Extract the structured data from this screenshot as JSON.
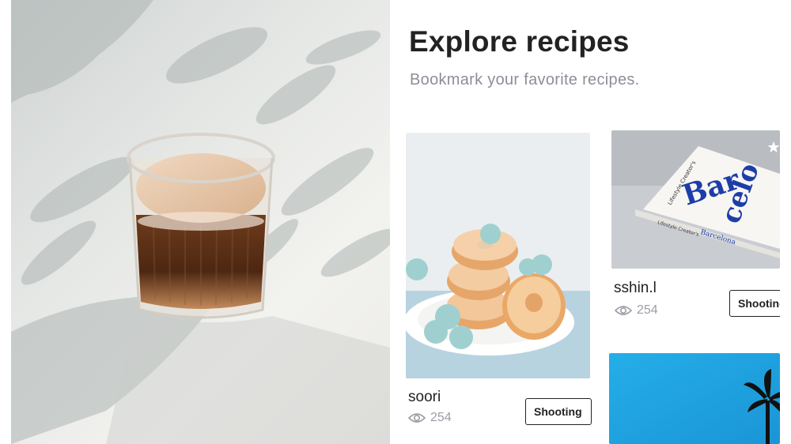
{
  "header": {
    "title": "Explore recipes",
    "subtitle": "Bookmark your favorite recipes."
  },
  "hero": {
    "image": "iced coffee glass on white table with leaf shadows"
  },
  "cards": [
    {
      "image": "glazed donuts on a white plate",
      "author": "soori",
      "views": "254",
      "tag": "Shooting"
    },
    {
      "image": "Lifestyle Creator's Barcelona book",
      "author": "sshin.l",
      "views": "254",
      "tag": "Shooting",
      "book_lines": [
        "Lifestyle Creator's",
        "Bar",
        "celo",
        "Lifestyle Creator's",
        "Barcelona"
      ]
    },
    {
      "image": "blue sky with palm tree"
    }
  ],
  "icons": {
    "views": "eye-icon",
    "bookmark": "star-icon"
  },
  "colors": {
    "text": "#222222",
    "muted": "#8b8f98",
    "sky": "#1aa3e4",
    "book_blue": "#1d3ea8"
  }
}
